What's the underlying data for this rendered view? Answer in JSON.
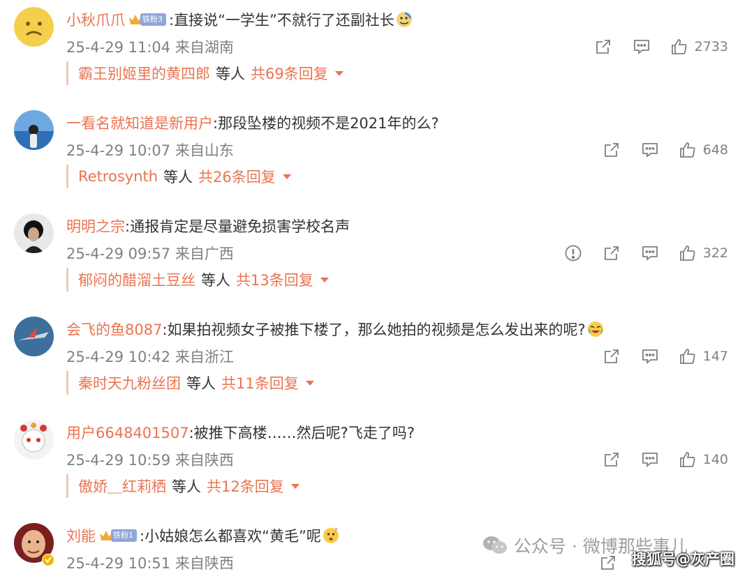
{
  "colors": {
    "accent": "#eb7350",
    "meta": "#808080",
    "text": "#333333"
  },
  "comments": [
    {
      "username": "小秋爪爪",
      "fan_badge": "铁粉3",
      "text": ":直接说“一学生”不就行了还副社长",
      "emoji": "doge-emoji",
      "time": "25-4-29 11:04",
      "location": "来自湖南",
      "likes": "2733",
      "reply_user": "霸王别姬里的黄四郎",
      "reply_mid": "等人",
      "reply_total": "共69条回复"
    },
    {
      "username": "一看名就知道是新用户",
      "text": ":那段坠楼的视频不是2021年的么?",
      "time": "25-4-29 10:07",
      "location": "来自山东",
      "likes": "648",
      "reply_user": "Retrosynth",
      "reply_mid": "等人",
      "reply_total": "共26条回复"
    },
    {
      "username": "明明之宗",
      "text": ":通报肯定是尽量避免损害学校名声",
      "time": "25-4-29 09:57",
      "location": "来自广西",
      "likes": "322",
      "reply_user": "郁闷的醋溜土豆丝",
      "reply_mid": "等人",
      "reply_total": "共13条回复"
    },
    {
      "username": "会飞的鱼8087",
      "text": ":如果拍视频女子被推下楼了，那么她拍的视频是怎么发出来的呢?",
      "emoji": "crying-laugh-emoji",
      "time": "25-4-29 10:42",
      "location": "来自浙江",
      "likes": "147",
      "reply_user": "秦时天九粉丝团",
      "reply_mid": "等人",
      "reply_total": "共11条回复"
    },
    {
      "username": "用户6648401507",
      "text": ":被推下高楼……然后呢?飞走了吗?",
      "time": "25-4-29 10:59",
      "location": "来自陕西",
      "likes": "140",
      "reply_user": "傲娇＿红莉栖",
      "reply_mid": "等人",
      "reply_total": "共12条回复"
    },
    {
      "username": "刘能",
      "fan_badge": "铁粉1",
      "text": ":小姑娘怎么都喜欢“黄毛”呢",
      "emoji": "thinking-emoji",
      "time": "25-4-29 10:51",
      "location": "来自陕西"
    }
  ],
  "watermark": {
    "text": "公众号 · 微博那些事儿",
    "sohu": "搜狐号@灰产圈"
  }
}
